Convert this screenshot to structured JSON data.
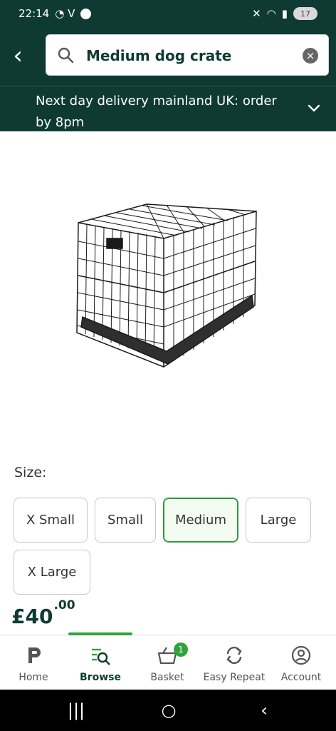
{
  "status_bar": {
    "time": "22:14",
    "app_glyphs": "◔ V",
    "battery": "17"
  },
  "search": {
    "query": "Medium dog crate"
  },
  "delivery": {
    "text": "Next day delivery mainland UK: order by 8pm"
  },
  "product": {
    "size_label": "Size:",
    "sizes": [
      {
        "label": "X Small",
        "selected": false
      },
      {
        "label": "Small",
        "selected": false
      },
      {
        "label": "Medium",
        "selected": true
      },
      {
        "label": "Large",
        "selected": false
      },
      {
        "label": "X Large",
        "selected": false
      }
    ],
    "price_main": "£40",
    "price_fraction": ".00"
  },
  "nav": {
    "home": "Home",
    "browse": "Browse",
    "basket": "Basket",
    "basket_count": "1",
    "easy_repeat": "Easy Repeat",
    "account": "Account"
  },
  "colors": {
    "header": "#0f3a33",
    "accent": "#2ea43a"
  }
}
